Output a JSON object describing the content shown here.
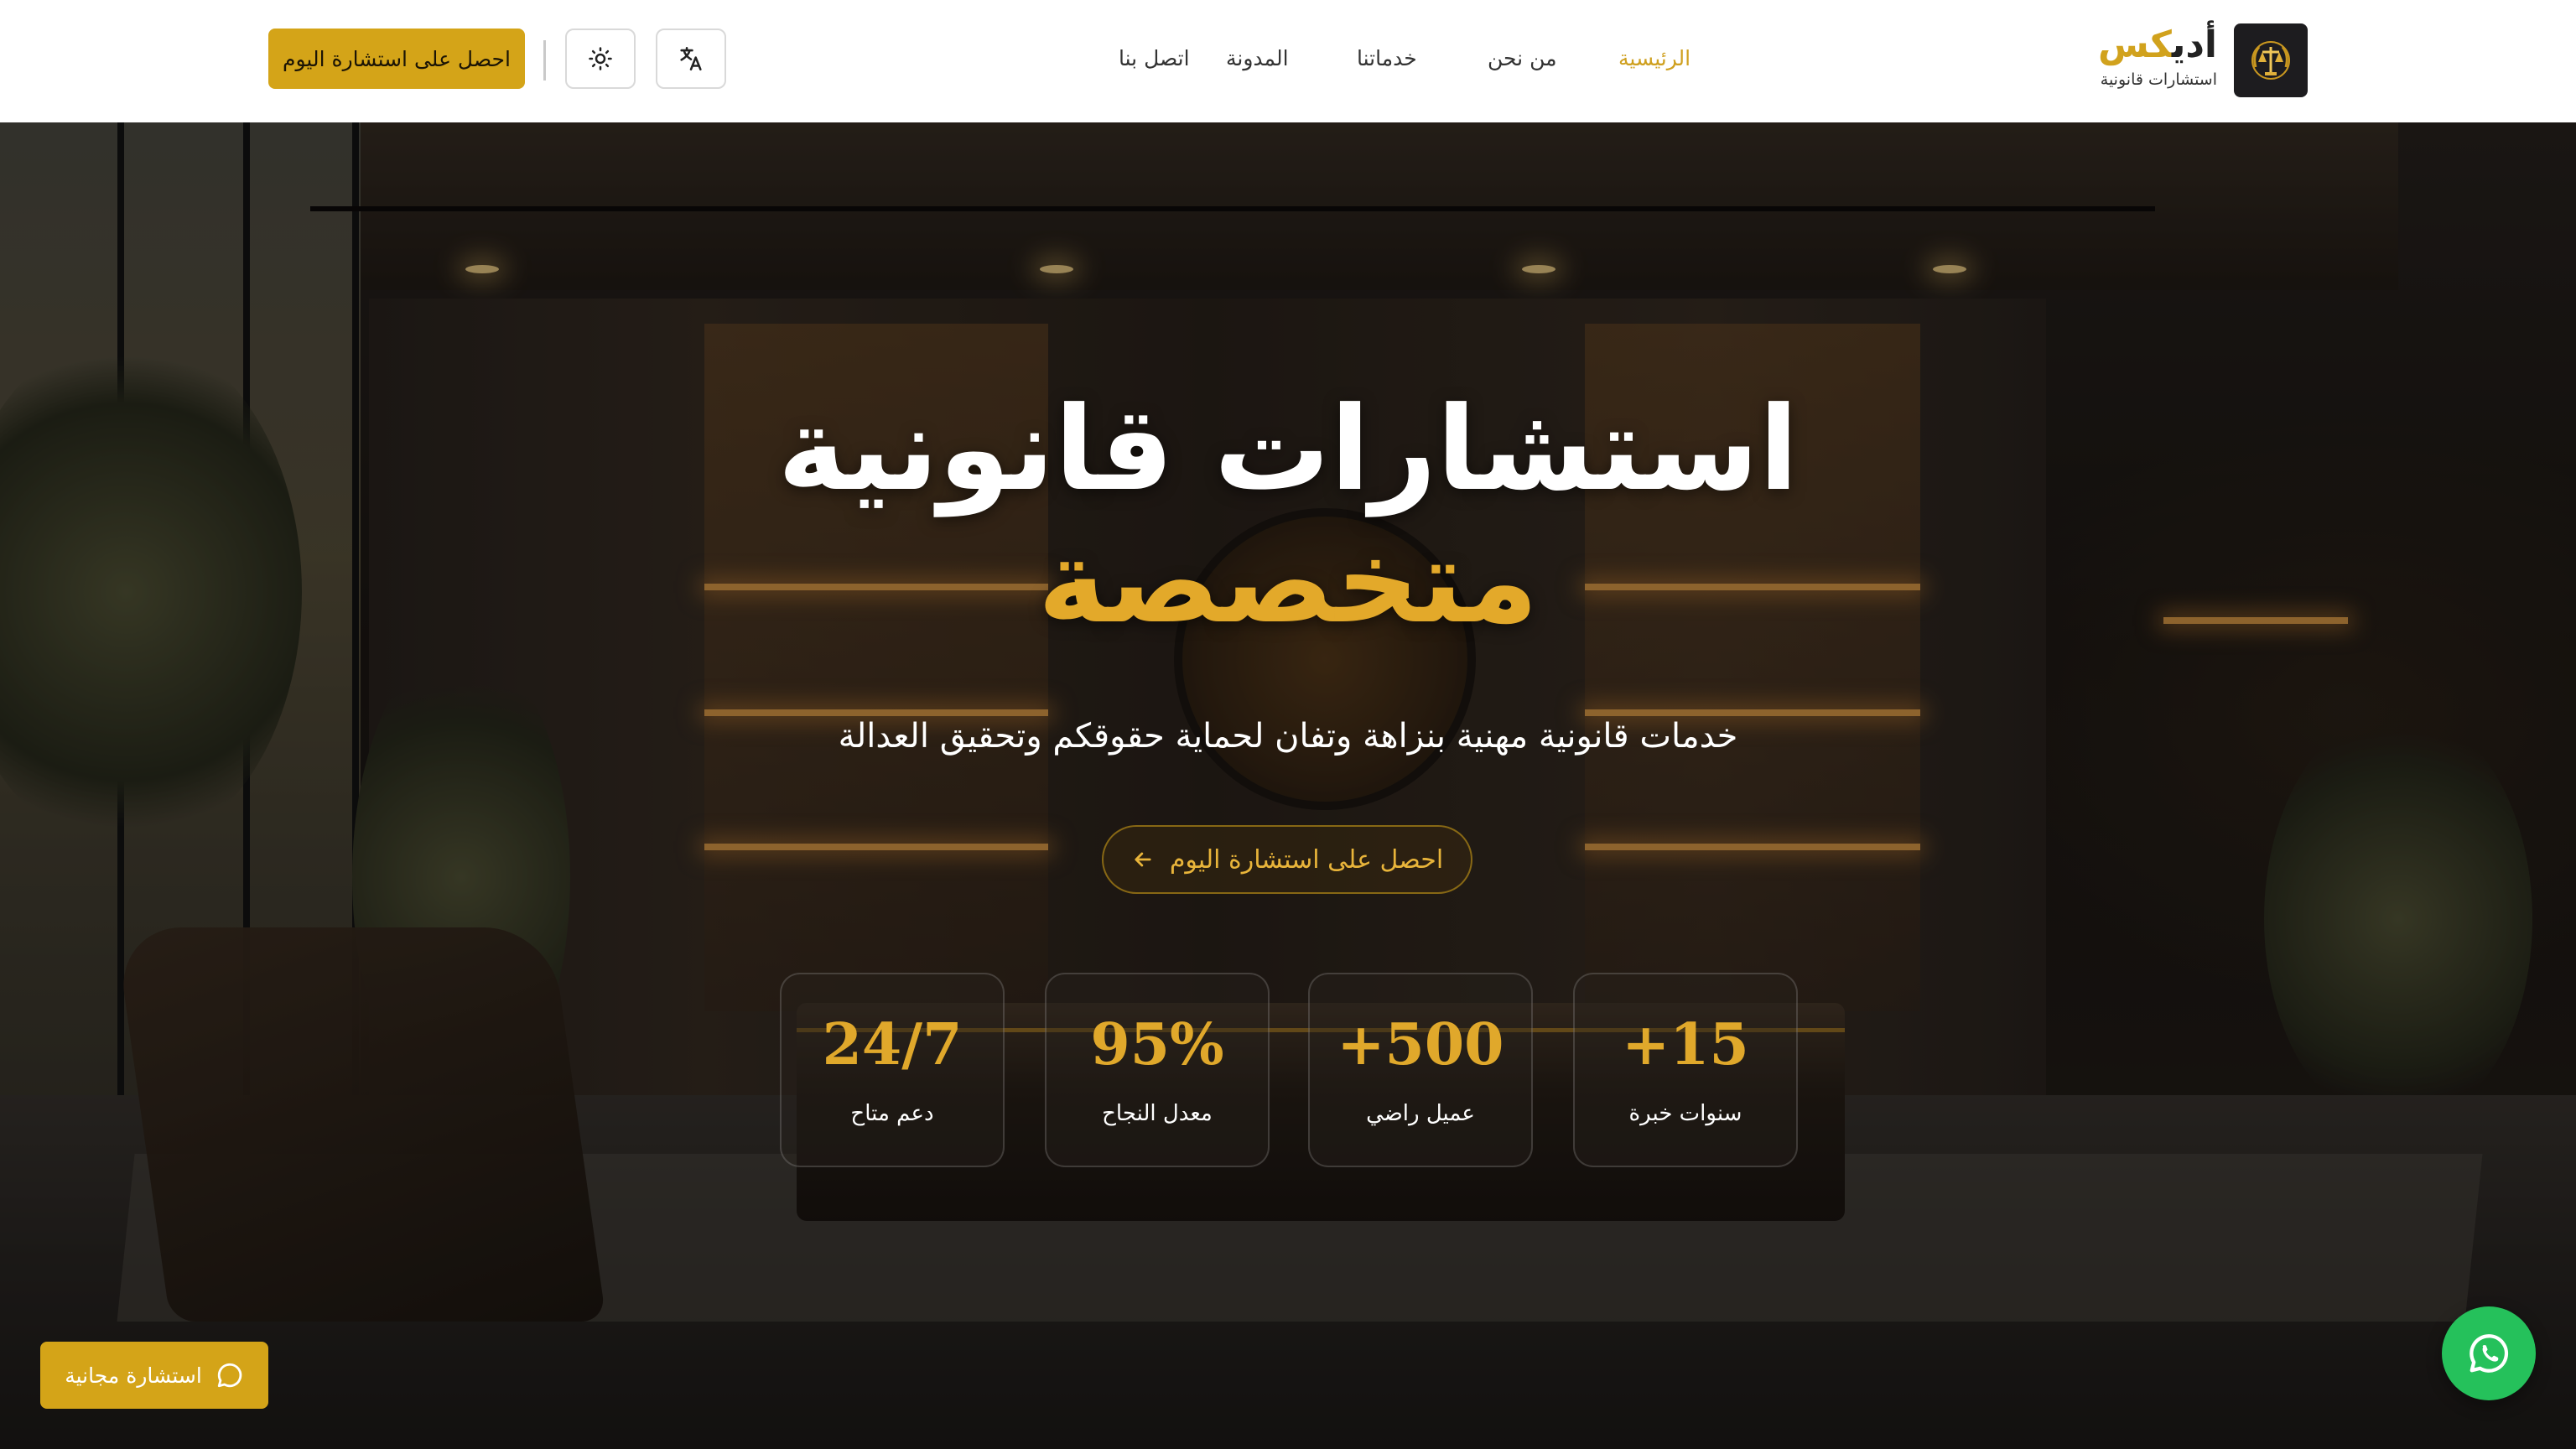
{
  "header": {
    "brand_name_part1": "أدي",
    "brand_name_part2": "كس",
    "brand_subtitle": "استشارات قانونية",
    "nav": [
      "الرئيسية",
      "من نحن",
      "خدماتنا",
      "المدونة",
      "اتصل بنا"
    ],
    "active_nav": "الرئيسية",
    "cta_label": "احصل على استشارة اليوم",
    "icons": [
      "scales-logo-icon",
      "translate-icon",
      "sun-icon"
    ]
  },
  "hero": {
    "title_line1": "استشارات قانونية",
    "title_line2": "متخصصة",
    "subtitle": "خدمات قانونية مهنية بنزاهة وتفان لحماية حقوقكم وتحقيق العدالة",
    "cta_label": "احصل على استشارة اليوم",
    "cta_icon": "arrow-left-icon"
  },
  "stats": [
    {
      "value": "+15",
      "label": "سنوات خبرة"
    },
    {
      "value": "+500",
      "label": "عميل راضي"
    },
    {
      "value": "95%",
      "label": "معدل النجاح"
    },
    {
      "value": "24/7",
      "label": "دعم متاح"
    }
  ],
  "floating": {
    "free_consult_label": "استشارة مجانية",
    "free_consult_icon": "chat-bubble-icon",
    "whatsapp_icon": "whatsapp-icon"
  },
  "colors": {
    "accent_gold": "#d4a418",
    "title_gold": "#e3a92a",
    "whatsapp_green": "#25c15b",
    "header_bg": "#ffffff"
  }
}
